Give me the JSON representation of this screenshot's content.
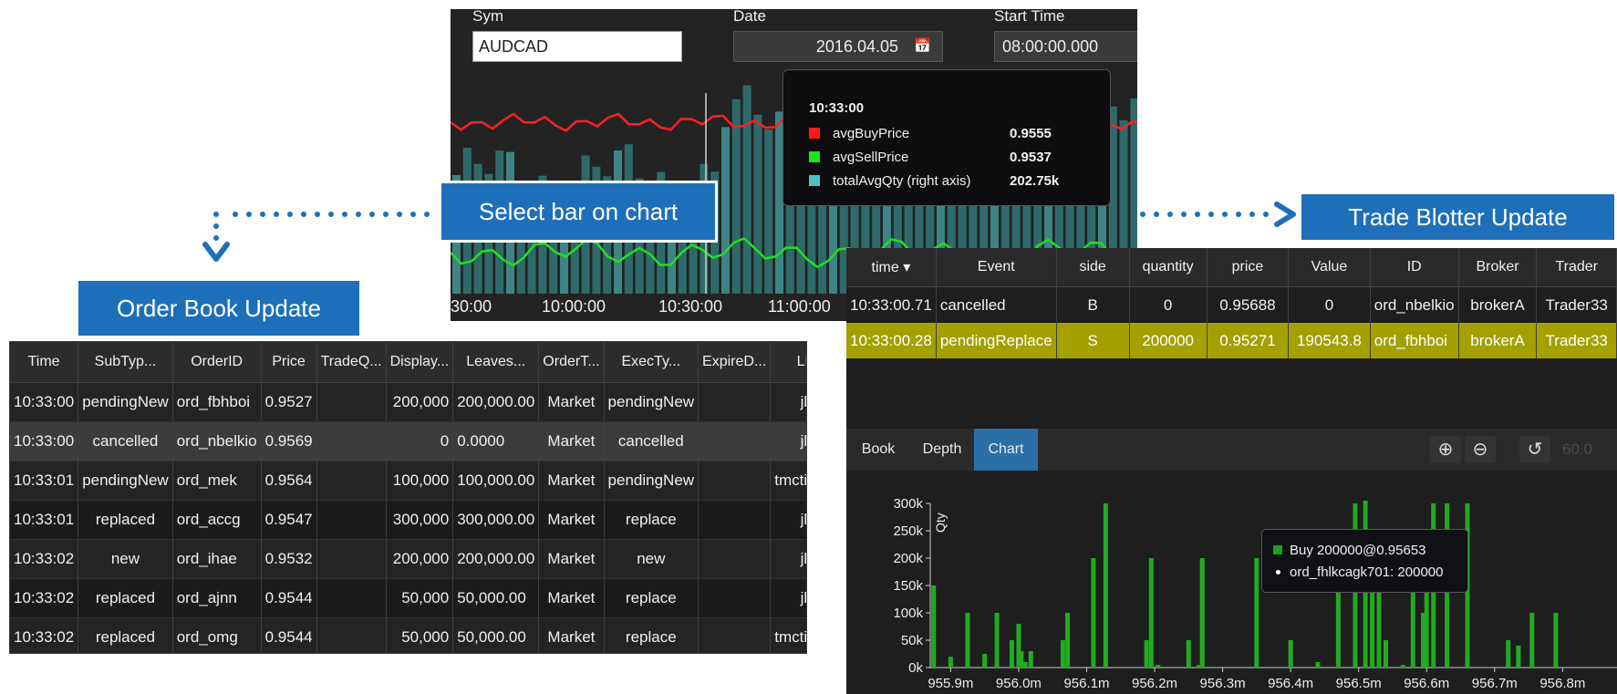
{
  "dashboard": {
    "sym_label": "Sym",
    "sym_value": "AUDCAD",
    "date_label": "Date",
    "date_value": "2016.04.05",
    "start_label": "Start Time",
    "start_value": "08:00:00.000",
    "x_ticks": [
      "30:00",
      "10:00:00",
      "10:30:00",
      "11:00:00"
    ],
    "tooltip": {
      "time": "10:33:00",
      "rows": [
        {
          "name": "avgBuyPrice",
          "value": "0.9555",
          "color": "#ff1a1a"
        },
        {
          "name": "avgSellPrice",
          "value": "0.9537",
          "color": "#19e619"
        },
        {
          "name": "totalAvgQty (right axis)",
          "value": "202.75k",
          "color": "#4fc3c3"
        }
      ]
    }
  },
  "callouts": {
    "select_bar": "Select bar on chart",
    "trade_blotter": "Trade Blotter Update",
    "order_book": "Order Book Update"
  },
  "order_book": {
    "columns": [
      "Time",
      "SubTyp...",
      "OrderID",
      "Price",
      "TradeQ...",
      "Display...",
      "Leaves...",
      "OrderT...",
      "ExecTy...",
      "ExpireD...",
      "LEI"
    ],
    "rows": [
      [
        "10:33:00",
        "pendingNew",
        "ord_fbhboi",
        "0.9527",
        "",
        "200,000",
        "200,000.00",
        "Market",
        "pendingNew",
        "",
        "jblogs"
      ],
      [
        "10:33:00",
        "cancelled",
        "ord_nbelkio",
        "0.9569",
        "",
        "0",
        "0.0000",
        "Market",
        "cancelled",
        "",
        "jblogs"
      ],
      [
        "10:33:01",
        "pendingNew",
        "ord_mek",
        "0.9564",
        "",
        "100,000",
        "100,000.00",
        "Market",
        "pendingNew",
        "",
        "tmctimmy"
      ],
      [
        "10:33:01",
        "replaced",
        "ord_accg",
        "0.9547",
        "",
        "300,000",
        "300,000.00",
        "Market",
        "replace",
        "",
        "jblogs"
      ],
      [
        "10:33:02",
        "new",
        "ord_ihae",
        "0.9532",
        "",
        "200,000",
        "200,000.00",
        "Market",
        "new",
        "",
        "jblogs"
      ],
      [
        "10:33:02",
        "replaced",
        "ord_ajnn",
        "0.9544",
        "",
        "50,000",
        "50,000.00",
        "Market",
        "replace",
        "",
        "jblogs"
      ],
      [
        "10:33:02",
        "replaced",
        "ord_omg",
        "0.9544",
        "",
        "50,000",
        "50,000.00",
        "Market",
        "replace",
        "",
        "tmctimmy"
      ]
    ]
  },
  "trade_blotter": {
    "columns": [
      "time ▾",
      "Event",
      "side",
      "quantity",
      "price",
      "Value",
      "ID",
      "Broker",
      "Trader"
    ],
    "rows": [
      [
        "10:33:00.71",
        "cancelled",
        "B",
        "0",
        "0.95688",
        "0",
        "ord_nbelkio",
        "brokerA",
        "Trader33"
      ],
      [
        "10:33:00.28",
        "pendingReplace",
        "S",
        "200000",
        "0.95271",
        "190543.8",
        "ord_fbhboi",
        "brokerA",
        "Trader33"
      ]
    ],
    "tabs": [
      "Book",
      "Depth",
      "Chart"
    ],
    "active_tab": "Chart",
    "zoom_value": "60.0",
    "icons": [
      "zoom-in-icon",
      "zoom-out-icon",
      "reset-icon"
    ]
  },
  "depth_tooltip": {
    "line1": "Buy 200000@0.95653",
    "line2": "ord_fhlkcagk701: 200000"
  },
  "chart_data": {
    "type": "bar",
    "ylabel": "Qty",
    "xlabel": "",
    "ylim": [
      0,
      300000
    ],
    "yticks": [
      "0k",
      "50k",
      "100k",
      "150k",
      "200k",
      "250k",
      "300k"
    ],
    "x_ticks": [
      "955.9m",
      "956.0m",
      "956.1m",
      "956.2m",
      "956.3m",
      "956.4m",
      "956.5m",
      "956.6m",
      "956.7m",
      "956.8m"
    ],
    "xlim": [
      955.87,
      956.88
    ],
    "color": "#22aa22",
    "points": [
      {
        "x": 955.875,
        "y": 150000
      },
      {
        "x": 955.9,
        "y": 20000
      },
      {
        "x": 955.925,
        "y": 100000
      },
      {
        "x": 955.95,
        "y": 25000
      },
      {
        "x": 955.968,
        "y": 100000
      },
      {
        "x": 955.99,
        "y": 50000
      },
      {
        "x": 956.0,
        "y": 80000
      },
      {
        "x": 956.004,
        "y": 30000
      },
      {
        "x": 956.01,
        "y": 10000
      },
      {
        "x": 956.018,
        "y": 30000
      },
      {
        "x": 956.065,
        "y": 50000
      },
      {
        "x": 956.072,
        "y": 100000
      },
      {
        "x": 956.11,
        "y": 200000
      },
      {
        "x": 956.128,
        "y": 300000
      },
      {
        "x": 956.188,
        "y": 50000
      },
      {
        "x": 956.195,
        "y": 200000
      },
      {
        "x": 956.205,
        "y": 5000
      },
      {
        "x": 956.25,
        "y": 50000
      },
      {
        "x": 956.265,
        "y": 5000
      },
      {
        "x": 956.27,
        "y": 200000
      },
      {
        "x": 956.35,
        "y": 200000
      },
      {
        "x": 956.4,
        "y": 50000
      },
      {
        "x": 956.44,
        "y": 10000
      },
      {
        "x": 956.47,
        "y": 150000
      },
      {
        "x": 956.495,
        "y": 300000
      },
      {
        "x": 956.51,
        "y": 305000
      },
      {
        "x": 956.52,
        "y": 200000
      },
      {
        "x": 956.53,
        "y": 150000
      },
      {
        "x": 956.54,
        "y": 50000
      },
      {
        "x": 956.565,
        "y": 5000
      },
      {
        "x": 956.58,
        "y": 150000
      },
      {
        "x": 956.595,
        "y": 100000
      },
      {
        "x": 956.6,
        "y": 200000
      },
      {
        "x": 956.61,
        "y": 300000
      },
      {
        "x": 956.63,
        "y": 300000
      },
      {
        "x": 956.66,
        "y": 300000
      },
      {
        "x": 956.72,
        "y": 50000
      },
      {
        "x": 956.735,
        "y": 40000
      },
      {
        "x": 956.755,
        "y": 100000
      },
      {
        "x": 956.79,
        "y": 100000
      }
    ]
  }
}
